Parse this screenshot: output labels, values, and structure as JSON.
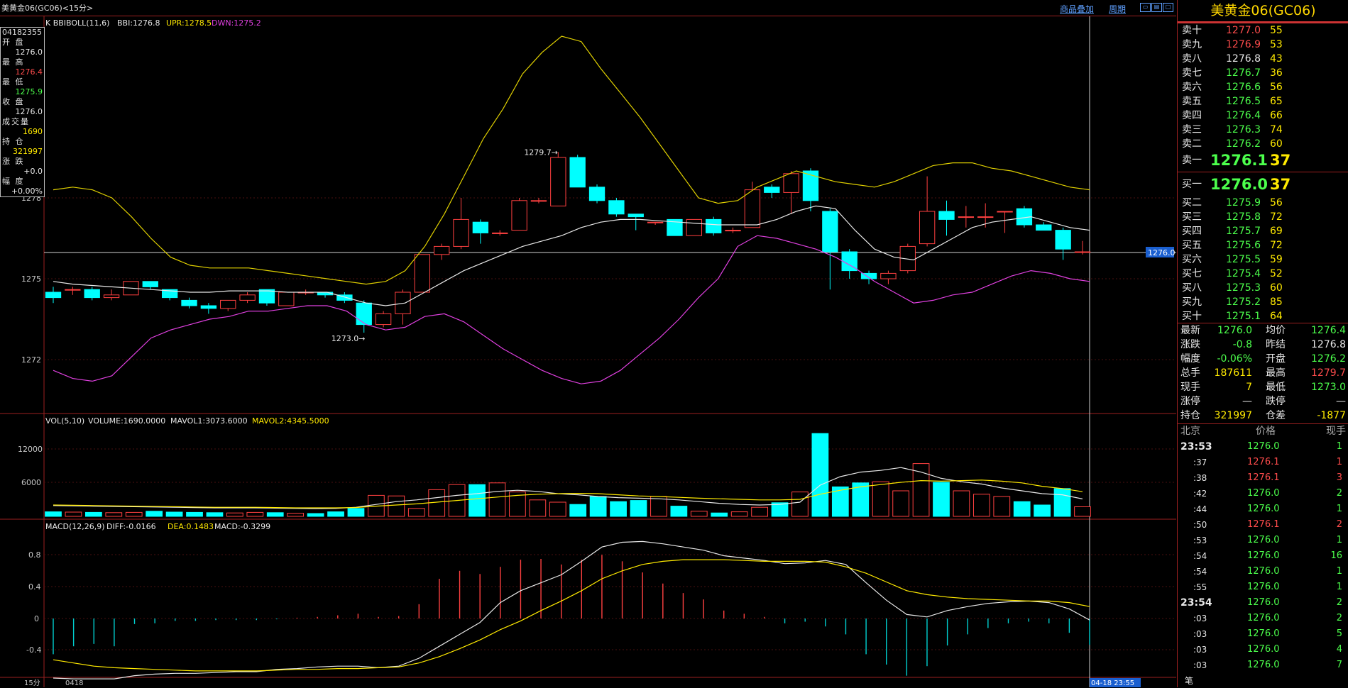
{
  "window": {
    "title": "美黄金06(GC06)<15分>",
    "links": [
      "商品叠加",
      "周期"
    ]
  },
  "kline_panel": {
    "indicator_label": "K  BBIBOLL(11,6)",
    "bbi_label": "BBI:1276.8",
    "upr_label": "UPR:1278.5",
    "dwn_label": "DWN:1275.2",
    "y_ticks": [
      "1278",
      "1275",
      "1272"
    ],
    "annotation_high": "1279.7→",
    "annotation_low": "1273.0→",
    "price_tag": "1276.0",
    "colors": {
      "up": "#ff4040",
      "down": "#00ffff",
      "upr": "#e0d000",
      "dwn": "#e040e0",
      "bbi": "#e8e8e8"
    }
  },
  "info_box": [
    {
      "label": "04182355",
      "value": null,
      "color": "#e8e8e8"
    },
    {
      "label": "开  盘",
      "value": "1276.0",
      "color": "#e8e8e8"
    },
    {
      "label": "最  高",
      "value": "1276.4",
      "color": "#ff4c4c"
    },
    {
      "label": "最  低",
      "value": "1275.9",
      "color": "#4cff4c"
    },
    {
      "label": "收  盘",
      "value": "1276.0",
      "color": "#e8e8e8"
    },
    {
      "label": "成交量",
      "value": "1690",
      "color": "#ffea00"
    },
    {
      "label": "持  仓",
      "value": "321997",
      "color": "#ffea00"
    },
    {
      "label": "涨  跌",
      "value": "+0.0",
      "color": "#e8e8e8"
    },
    {
      "label": "幅  度",
      "value": "+0.00%",
      "color": "#e8e8e8"
    }
  ],
  "vol_panel": {
    "label": "VOL(5,10)",
    "volume_label": "VOLUME:1690.0000",
    "mavol1_label": "MAVOL1:3073.6000",
    "mavol2_label": "MAVOL2:4345.5000",
    "y_ticks": [
      "12000",
      "6000"
    ]
  },
  "macd_panel": {
    "label": "MACD(12,26,9)",
    "diff_label": "DIFF:-0.0166",
    "dea_label": "DEA:0.1483",
    "macd_label": "MACD:-0.3299",
    "y_ticks": [
      "0.8",
      "0.4",
      "0",
      "-0.4"
    ]
  },
  "bottom_bar": {
    "period": "15分",
    "date": "0418",
    "cursor_time": "04-18 23:55"
  },
  "chart_data": {
    "type": "candlestick",
    "candles": [
      [
        1274.5,
        1274.3,
        1274.7,
        1274.1
      ],
      [
        1274.6,
        1274.6,
        1274.7,
        1274.4
      ],
      [
        1274.6,
        1274.3,
        1274.7,
        1274.2
      ],
      [
        1274.3,
        1274.4,
        1274.6,
        1274.2
      ],
      [
        1274.4,
        1274.9,
        1274.9,
        1274.4
      ],
      [
        1274.9,
        1274.7,
        1274.9,
        1274.6
      ],
      [
        1274.6,
        1274.3,
        1274.6,
        1274.2
      ],
      [
        1274.2,
        1274.0,
        1274.3,
        1273.9
      ],
      [
        1274.0,
        1273.9,
        1274.1,
        1273.7
      ],
      [
        1273.9,
        1274.2,
        1274.2,
        1273.8
      ],
      [
        1274.2,
        1274.4,
        1274.5,
        1274.1
      ],
      [
        1274.6,
        1274.1,
        1274.6,
        1274.0
      ],
      [
        1274.0,
        1274.5,
        1274.5,
        1274.0
      ],
      [
        1274.5,
        1274.5,
        1274.6,
        1274.4
      ],
      [
        1274.5,
        1274.4,
        1274.5,
        1274.3
      ],
      [
        1274.4,
        1274.2,
        1274.5,
        1274.1
      ],
      [
        1274.1,
        1273.3,
        1274.2,
        1273.0
      ],
      [
        1273.3,
        1273.7,
        1273.8,
        1273.2
      ],
      [
        1273.7,
        1274.5,
        1274.6,
        1273.3
      ],
      [
        1274.5,
        1275.9,
        1275.9,
        1274.5
      ],
      [
        1275.9,
        1276.2,
        1276.3,
        1275.7
      ],
      [
        1276.2,
        1277.2,
        1278.0,
        1276.1
      ],
      [
        1277.1,
        1276.7,
        1277.2,
        1276.3
      ],
      [
        1276.7,
        1276.7,
        1276.8,
        1276.6
      ],
      [
        1276.8,
        1277.9,
        1278.0,
        1276.8
      ],
      [
        1277.9,
        1277.9,
        1278.0,
        1277.8
      ],
      [
        1277.7,
        1279.5,
        1279.7,
        1277.7
      ],
      [
        1279.5,
        1278.4,
        1279.6,
        1278.4
      ],
      [
        1278.4,
        1277.9,
        1278.5,
        1277.8
      ],
      [
        1277.9,
        1277.4,
        1278.0,
        1277.3
      ],
      [
        1277.4,
        1277.3,
        1277.4,
        1276.8
      ],
      [
        1277.1,
        1277.1,
        1277.1,
        1277.0
      ],
      [
        1277.2,
        1276.6,
        1277.2,
        1276.6
      ],
      [
        1276.6,
        1277.2,
        1277.2,
        1276.6
      ],
      [
        1277.2,
        1276.7,
        1277.3,
        1276.6
      ],
      [
        1276.8,
        1276.8,
        1276.9,
        1276.7
      ],
      [
        1276.9,
        1278.3,
        1278.6,
        1276.9
      ],
      [
        1278.4,
        1278.2,
        1278.5,
        1278.0
      ],
      [
        1278.2,
        1278.9,
        1279.0,
        1277.4
      ],
      [
        1279.0,
        1277.9,
        1279.1,
        1277.5
      ],
      [
        1277.5,
        1276.0,
        1277.6,
        1274.6
      ],
      [
        1276.0,
        1275.3,
        1276.1,
        1275.0
      ],
      [
        1275.2,
        1275.0,
        1275.3,
        1274.8
      ],
      [
        1275.0,
        1275.2,
        1275.3,
        1274.8
      ],
      [
        1275.3,
        1276.2,
        1276.3,
        1275.2
      ],
      [
        1276.3,
        1277.5,
        1278.8,
        1276.2
      ],
      [
        1277.5,
        1277.2,
        1277.9,
        1276.6
      ],
      [
        1277.3,
        1277.3,
        1277.7,
        1276.9
      ],
      [
        1277.3,
        1277.3,
        1277.8,
        1276.9
      ],
      [
        1277.5,
        1277.5,
        1277.5,
        1276.7
      ],
      [
        1277.6,
        1277.0,
        1277.7,
        1276.9
      ],
      [
        1277.0,
        1276.8,
        1277.1,
        1276.8
      ],
      [
        1276.8,
        1276.1,
        1276.9,
        1275.7
      ],
      [
        1276.0,
        1276.0,
        1276.4,
        1275.9
      ]
    ],
    "bbi": [
      1274.9,
      1274.8,
      1274.75,
      1274.7,
      1274.65,
      1274.6,
      1274.55,
      1274.5,
      1274.5,
      1274.55,
      1274.55,
      1274.55,
      1274.5,
      1274.5,
      1274.5,
      1274.3,
      1274.1,
      1274.0,
      1274.1,
      1274.5,
      1274.9,
      1275.3,
      1275.6,
      1275.9,
      1276.2,
      1276.4,
      1276.6,
      1276.9,
      1277.1,
      1277.2,
      1277.2,
      1277.15,
      1277.1,
      1277.05,
      1277.0,
      1277.0,
      1277.0,
      1277.2,
      1277.5,
      1277.7,
      1277.6,
      1276.8,
      1276.1,
      1275.8,
      1275.7,
      1276.1,
      1276.5,
      1276.9,
      1277.1,
      1277.2,
      1277.3,
      1277.1,
      1276.9,
      1276.8
    ],
    "upr": [
      1278.3,
      1278.4,
      1278.3,
      1278.0,
      1277.3,
      1276.5,
      1275.8,
      1275.5,
      1275.4,
      1275.4,
      1275.4,
      1275.3,
      1275.2,
      1275.1,
      1275.0,
      1274.9,
      1274.8,
      1274.9,
      1275.3,
      1276.2,
      1277.4,
      1278.8,
      1280.2,
      1281.3,
      1282.6,
      1283.4,
      1284.0,
      1283.8,
      1282.8,
      1281.9,
      1281.0,
      1280.0,
      1279.0,
      1278.0,
      1277.8,
      1277.9,
      1278.4,
      1278.7,
      1279.0,
      1278.8,
      1278.6,
      1278.5,
      1278.4,
      1278.6,
      1278.9,
      1279.2,
      1279.3,
      1279.3,
      1279.1,
      1279.0,
      1278.8,
      1278.6,
      1278.4,
      1278.3
    ],
    "dwn": [
      1271.6,
      1271.3,
      1271.2,
      1271.4,
      1272.1,
      1272.8,
      1273.1,
      1273.3,
      1273.5,
      1273.6,
      1273.8,
      1273.8,
      1273.9,
      1274.0,
      1274.0,
      1273.8,
      1273.3,
      1273.1,
      1273.2,
      1273.6,
      1273.7,
      1273.4,
      1272.9,
      1272.4,
      1272.0,
      1271.6,
      1271.3,
      1271.1,
      1271.2,
      1271.6,
      1272.2,
      1272.8,
      1273.5,
      1274.3,
      1275.0,
      1276.2,
      1276.6,
      1276.5,
      1276.3,
      1276.1,
      1275.8,
      1275.4,
      1274.9,
      1274.5,
      1274.1,
      1274.2,
      1274.4,
      1274.5,
      1274.8,
      1275.1,
      1275.3,
      1275.2,
      1275.0,
      1274.9
    ],
    "volume": [
      800,
      750,
      700,
      650,
      700,
      900,
      750,
      700,
      650,
      600,
      700,
      650,
      550,
      500,
      800,
      1400,
      3700,
      3600,
      1400,
      4700,
      5600,
      5600,
      5900,
      4300,
      2900,
      2500,
      2100,
      3500,
      2600,
      2800,
      3500,
      1800,
      900,
      600,
      800,
      1600,
      2400,
      4300,
      14600,
      5200,
      5900,
      6100,
      4500,
      9300,
      6000,
      4500,
      3900,
      3500,
      2600,
      2000,
      4900,
      1690
    ],
    "mavol1": [
      1900,
      1850,
      1800,
      1750,
      1700,
      1650,
      1600,
      1550,
      1500,
      1500,
      1500,
      1450,
      1400,
      1350,
      1400,
      1600,
      2100,
      2600,
      2900,
      3300,
      3700,
      4000,
      4400,
      4600,
      4400,
      4000,
      3800,
      3500,
      3300,
      3200,
      3100,
      2900,
      2600,
      2300,
      2100,
      2000,
      2100,
      2500,
      5500,
      7000,
      7800,
      8100,
      8600,
      7800,
      6700,
      6100,
      5700,
      5000,
      4500,
      4000,
      3800,
      3073
    ],
    "mavol2": [
      2000,
      1950,
      1900,
      1850,
      1800,
      1750,
      1700,
      1650,
      1600,
      1600,
      1600,
      1550,
      1500,
      1500,
      1500,
      1550,
      1800,
      2000,
      2200,
      2500,
      2800,
      3100,
      3400,
      3700,
      3900,
      4000,
      4050,
      4000,
      3800,
      3600,
      3500,
      3350,
      3200,
      3100,
      3000,
      2900,
      2900,
      3000,
      3900,
      4600,
      5200,
      5600,
      6000,
      6300,
      6200,
      6300,
      6400,
      6200,
      5900,
      5300,
      4900,
      4345
    ],
    "diff": [
      -0.75,
      -0.76,
      -0.76,
      -0.76,
      -0.72,
      -0.7,
      -0.69,
      -0.69,
      -0.68,
      -0.67,
      -0.67,
      -0.64,
      -0.63,
      -0.61,
      -0.6,
      -0.6,
      -0.62,
      -0.6,
      -0.5,
      -0.35,
      -0.2,
      -0.05,
      0.2,
      0.35,
      0.45,
      0.55,
      0.72,
      0.9,
      0.96,
      0.97,
      0.94,
      0.9,
      0.86,
      0.79,
      0.76,
      0.73,
      0.69,
      0.7,
      0.73,
      0.68,
      0.45,
      0.23,
      0.05,
      0.02,
      0.1,
      0.15,
      0.19,
      0.21,
      0.22,
      0.2,
      0.12,
      -0.02
    ],
    "dea": [
      -0.52,
      -0.56,
      -0.6,
      -0.62,
      -0.63,
      -0.64,
      -0.65,
      -0.66,
      -0.66,
      -0.66,
      -0.66,
      -0.65,
      -0.64,
      -0.64,
      -0.63,
      -0.63,
      -0.62,
      -0.61,
      -0.56,
      -0.48,
      -0.38,
      -0.27,
      -0.14,
      -0.03,
      0.1,
      0.22,
      0.35,
      0.5,
      0.6,
      0.68,
      0.72,
      0.74,
      0.74,
      0.74,
      0.73,
      0.72,
      0.72,
      0.72,
      0.71,
      0.65,
      0.57,
      0.46,
      0.35,
      0.3,
      0.27,
      0.25,
      0.24,
      0.23,
      0.22,
      0.22,
      0.2,
      0.15
    ],
    "macd": [
      -0.45,
      -0.35,
      -0.32,
      -0.35,
      -0.07,
      -0.06,
      -0.03,
      -0.03,
      -0.02,
      -0.02,
      -0.02,
      -0.01,
      0.01,
      0.02,
      0.04,
      0.06,
      0.02,
      0.03,
      0.18,
      0.5,
      0.6,
      0.56,
      0.65,
      0.74,
      0.75,
      0.68,
      0.74,
      0.8,
      0.72,
      0.58,
      0.44,
      0.32,
      0.24,
      0.1,
      0.06,
      0.02,
      -0.06,
      -0.04,
      -0.1,
      -0.2,
      -0.45,
      -0.58,
      -0.72,
      -0.6,
      -0.34,
      -0.2,
      -0.12,
      -0.06,
      -0.04,
      -0.06,
      -0.18,
      -0.33
    ]
  },
  "right_panel": {
    "title": "美黄金06(GC06)",
    "asks": [
      {
        "label": "卖十",
        "price": "1277.0",
        "qty": "55",
        "pc": "r"
      },
      {
        "label": "卖九",
        "price": "1276.9",
        "qty": "53",
        "pc": "r"
      },
      {
        "label": "卖八",
        "price": "1276.8",
        "qty": "43",
        "pc": "w"
      },
      {
        "label": "卖七",
        "price": "1276.7",
        "qty": "36",
        "pc": "g"
      },
      {
        "label": "卖六",
        "price": "1276.6",
        "qty": "56",
        "pc": "g"
      },
      {
        "label": "卖五",
        "price": "1276.5",
        "qty": "65",
        "pc": "g"
      },
      {
        "label": "卖四",
        "price": "1276.4",
        "qty": "66",
        "pc": "g"
      },
      {
        "label": "卖三",
        "price": "1276.3",
        "qty": "74",
        "pc": "g"
      },
      {
        "label": "卖二",
        "price": "1276.2",
        "qty": "60",
        "pc": "g"
      }
    ],
    "ask1": {
      "label": "卖一",
      "price": "1276.1",
      "qty": "37"
    },
    "bid1": {
      "label": "买一",
      "price": "1276.0",
      "qty": "37"
    },
    "bids": [
      {
        "label": "买二",
        "price": "1275.9",
        "qty": "56"
      },
      {
        "label": "买三",
        "price": "1275.8",
        "qty": "72"
      },
      {
        "label": "买四",
        "price": "1275.7",
        "qty": "69"
      },
      {
        "label": "买五",
        "price": "1275.6",
        "qty": "72"
      },
      {
        "label": "买六",
        "price": "1275.5",
        "qty": "59"
      },
      {
        "label": "买七",
        "price": "1275.4",
        "qty": "52"
      },
      {
        "label": "买八",
        "price": "1275.3",
        "qty": "60"
      },
      {
        "label": "买九",
        "price": "1275.2",
        "qty": "85"
      },
      {
        "label": "买十",
        "price": "1275.1",
        "qty": "64"
      }
    ],
    "stats": [
      {
        "l1": "最新",
        "v1": "1276.0",
        "c1": "g",
        "l2": "均价",
        "v2": "1276.4",
        "c2": "g"
      },
      {
        "l1": "涨跌",
        "v1": "-0.8",
        "c1": "g",
        "l2": "昨结",
        "v2": "1276.8",
        "c2": "w"
      },
      {
        "l1": "幅度",
        "v1": "-0.06%",
        "c1": "g",
        "l2": "开盘",
        "v2": "1276.2",
        "c2": "g"
      },
      {
        "l1": "总手",
        "v1": "187611",
        "c1": "y",
        "l2": "最高",
        "v2": "1279.7",
        "c2": "r"
      },
      {
        "l1": "现手",
        "v1": "7",
        "c1": "y",
        "l2": "最低",
        "v2": "1273.0",
        "c2": "g"
      },
      {
        "l1": "涨停",
        "v1": "—",
        "c1": "w",
        "l2": "跌停",
        "v2": "—",
        "c2": "w"
      },
      {
        "l1": "持仓",
        "v1": "321997",
        "c1": "y",
        "l2": "仓差",
        "v2": "-1877",
        "c2": "y"
      }
    ],
    "ticks_header": {
      "time": "北京",
      "price": "价格",
      "qty": "现手"
    },
    "ticks": [
      {
        "time": "23:53",
        "price": "1276.0",
        "qty": "1",
        "qc": "g",
        "big": true
      },
      {
        "time": ":37",
        "price": "1276.1",
        "qty": "1",
        "qc": "r",
        "big": false
      },
      {
        "time": ":38",
        "price": "1276.1",
        "qty": "3",
        "qc": "r",
        "big": false
      },
      {
        "time": ":42",
        "price": "1276.0",
        "qty": "2",
        "qc": "g",
        "big": false
      },
      {
        "time": ":44",
        "price": "1276.0",
        "qty": "1",
        "qc": "g",
        "big": false
      },
      {
        "time": ":50",
        "price": "1276.1",
        "qty": "2",
        "qc": "r",
        "big": false
      },
      {
        "time": ":53",
        "price": "1276.0",
        "qty": "1",
        "qc": "g",
        "big": false
      },
      {
        "time": ":54",
        "price": "1276.0",
        "qty": "16",
        "qc": "g",
        "big": false
      },
      {
        "time": ":54",
        "price": "1276.0",
        "qty": "1",
        "qc": "g",
        "big": false
      },
      {
        "time": ":55",
        "price": "1276.0",
        "qty": "1",
        "qc": "g",
        "big": false
      },
      {
        "time": "23:54",
        "price": "1276.0",
        "qty": "2",
        "qc": "g",
        "big": true
      },
      {
        "time": ":03",
        "price": "1276.0",
        "qty": "2",
        "qc": "g",
        "big": false
      },
      {
        "time": ":03",
        "price": "1276.0",
        "qty": "5",
        "qc": "g",
        "big": false
      },
      {
        "time": ":03",
        "price": "1276.0",
        "qty": "4",
        "qc": "g",
        "big": false
      },
      {
        "time": ":03",
        "price": "1276.0",
        "qty": "7",
        "qc": "g",
        "big": false
      }
    ],
    "footer_label": "笔"
  }
}
